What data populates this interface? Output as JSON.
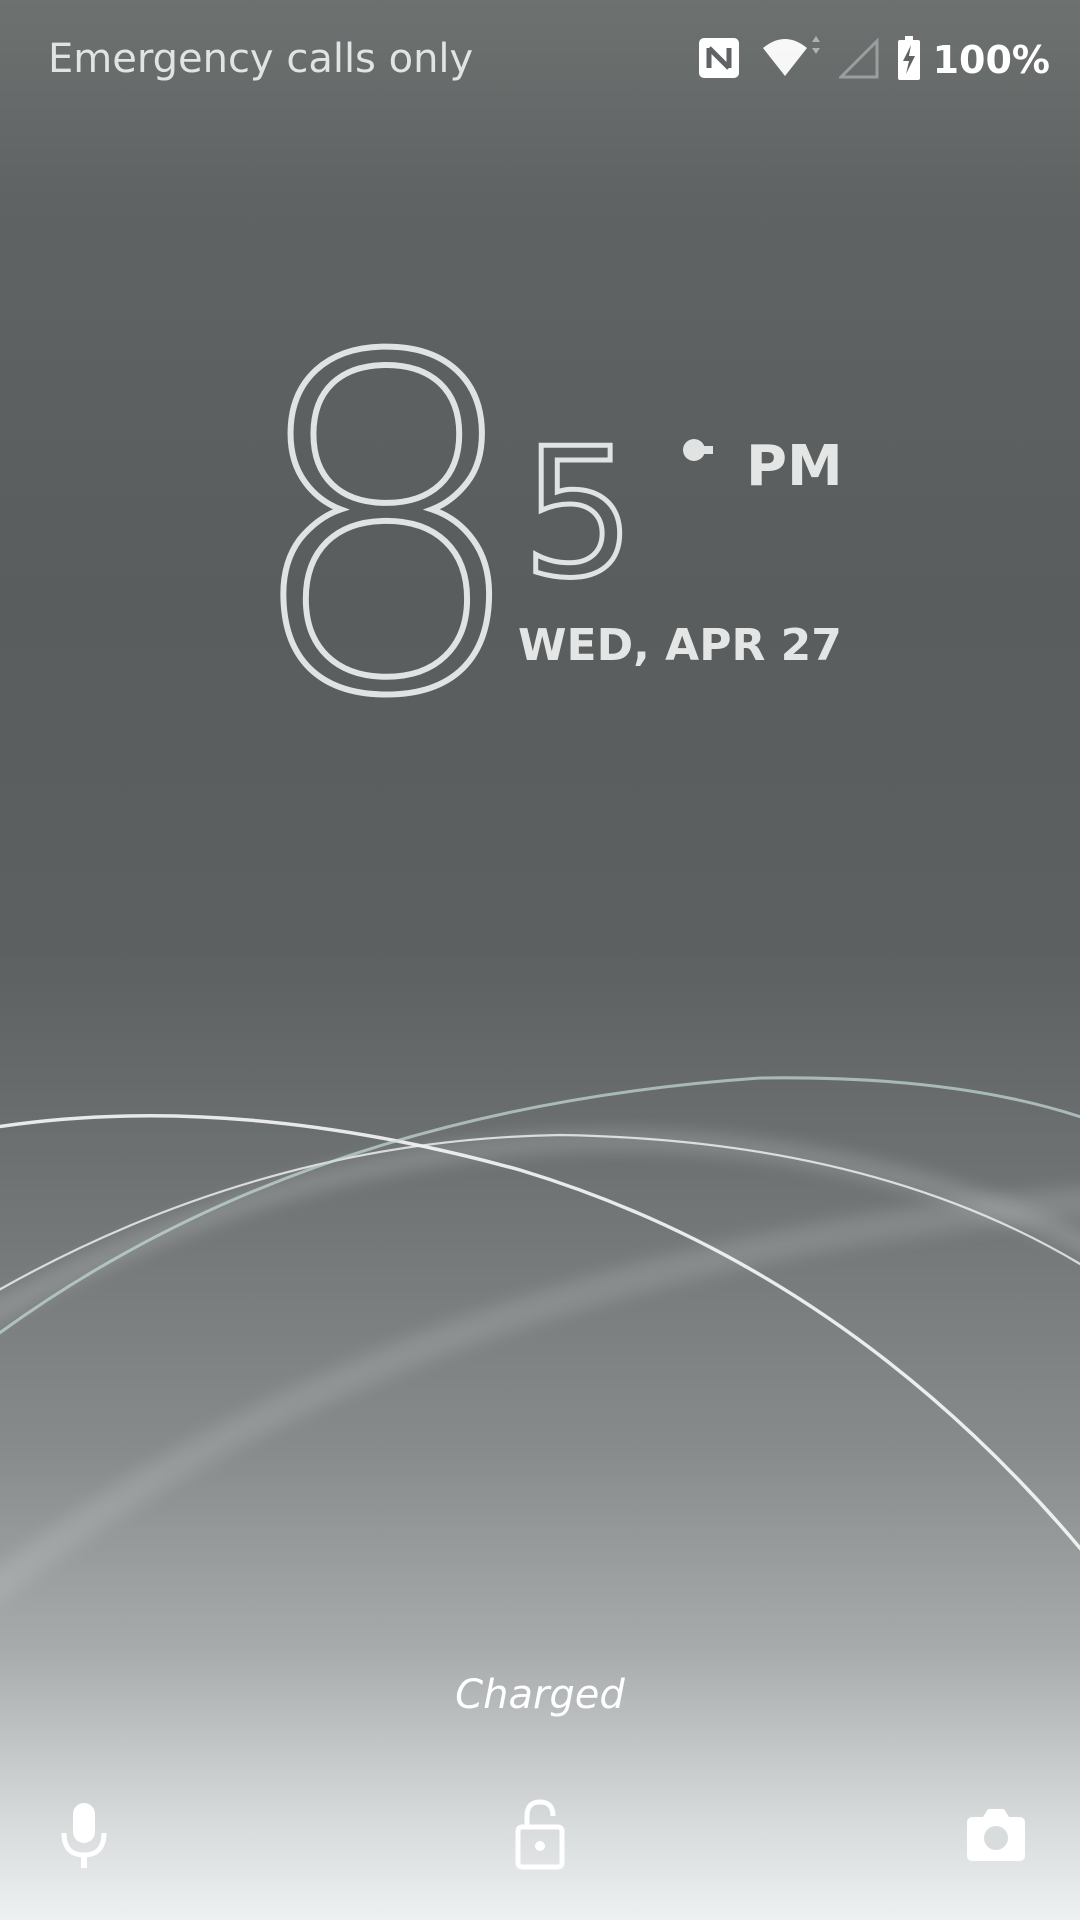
{
  "status_bar": {
    "carrier_text": "Emergency calls only",
    "battery_percent": "100%",
    "icons": [
      "nfc-icon",
      "wifi-icon",
      "cell-signal-icon",
      "battery-charging-icon"
    ]
  },
  "clock": {
    "hour": "8",
    "minute": "5",
    "ampm": "PM",
    "date": "WED, APR 27"
  },
  "lockscreen": {
    "charge_status": "Charged"
  },
  "bottom_actions": {
    "left": "microphone-icon",
    "center": "unlock-icon",
    "right": "camera-icon"
  },
  "colors": {
    "text_primary": "#e4e6e6",
    "background_top": "#5f6363",
    "background_bottom": "#eef1f1"
  }
}
